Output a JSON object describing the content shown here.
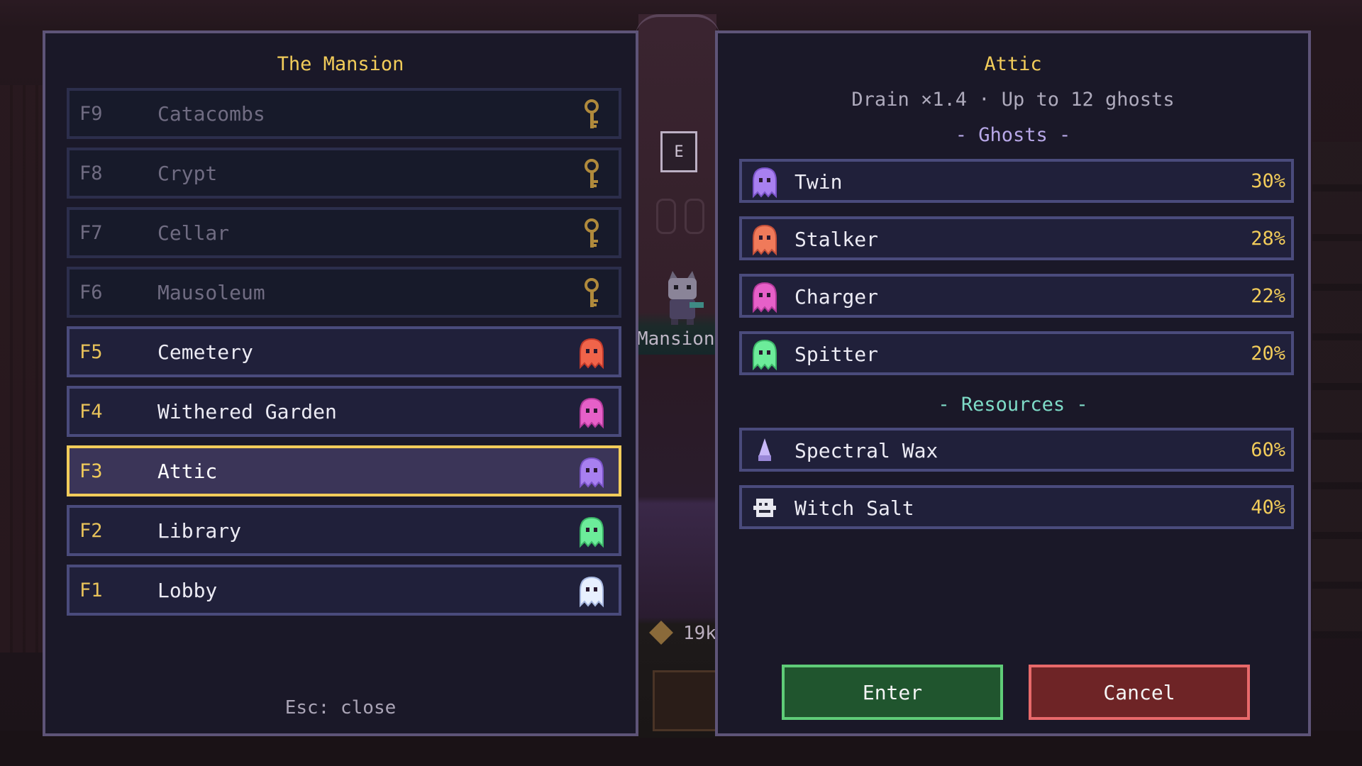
{
  "left_panel": {
    "title": "The Mansion",
    "floors": [
      {
        "code": "F9",
        "name": "Catacombs",
        "state": "locked",
        "icon": "key-icon"
      },
      {
        "code": "F8",
        "name": "Crypt",
        "state": "locked",
        "icon": "key-icon"
      },
      {
        "code": "F7",
        "name": "Cellar",
        "state": "locked",
        "icon": "key-icon"
      },
      {
        "code": "F6",
        "name": "Mausoleum",
        "state": "locked",
        "icon": "key-icon"
      },
      {
        "code": "F5",
        "name": "Cemetery",
        "state": "open",
        "icon": "red-ghost-icon"
      },
      {
        "code": "F4",
        "name": "Withered Garden",
        "state": "open",
        "icon": "pink-ghost-icon"
      },
      {
        "code": "F3",
        "name": "Attic",
        "state": "selected",
        "icon": "purple-ghost-icon"
      },
      {
        "code": "F2",
        "name": "Library",
        "state": "open",
        "icon": "green-ghost-icon"
      },
      {
        "code": "F1",
        "name": "Lobby",
        "state": "open",
        "icon": "white-ghost-icon"
      }
    ],
    "hint": "Esc: close"
  },
  "center": {
    "interact_key": "E",
    "location_label": "Mansion",
    "currency_value": "19k"
  },
  "right_panel": {
    "title": "Attic",
    "stats": "Drain ×1.4 · Up to 12 ghosts",
    "ghosts_header": "- Ghosts -",
    "ghosts": [
      {
        "name": "Twin",
        "pct": "30%",
        "icon": "purple-ghost-icon"
      },
      {
        "name": "Stalker",
        "pct": "28%",
        "icon": "orange-ghost-icon"
      },
      {
        "name": "Charger",
        "pct": "22%",
        "icon": "pink-ghost-icon"
      },
      {
        "name": "Spitter",
        "pct": "20%",
        "icon": "green-ghost-icon"
      }
    ],
    "resources_header": "- Resources -",
    "resources": [
      {
        "name": "Spectral Wax",
        "pct": "60%",
        "icon": "wax-icon"
      },
      {
        "name": "Witch Salt",
        "pct": "40%",
        "icon": "salt-icon"
      }
    ],
    "enter_label": "Enter",
    "cancel_label": "Cancel"
  },
  "colors": {
    "accent_gold": "#f2cc5a",
    "panel_border": "#5e5478",
    "enter_green": "#5fcc78",
    "cancel_red": "#e8696a"
  }
}
